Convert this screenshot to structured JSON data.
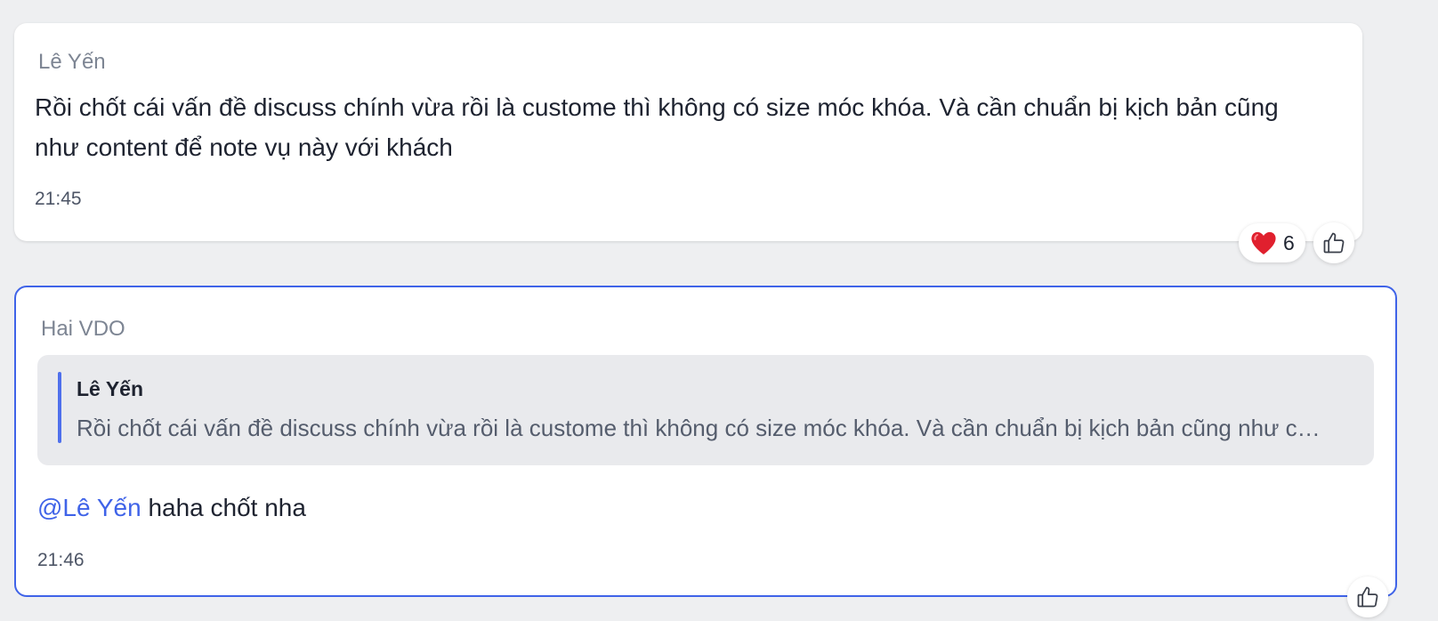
{
  "messages": [
    {
      "sender": "Lê Yến",
      "text": "Rồi chốt cái vấn đề discuss chính vừa rồi là custome thì không có size móc khóa. Và cần chuẩn bị kịch bản cũng như content để note vụ này với khách",
      "time": "21:45",
      "reactions": [
        {
          "icon": "heart-icon",
          "emoji": "❤️",
          "count": "6"
        }
      ],
      "like_icon": "thumbs-up-icon"
    },
    {
      "sender": "Hai VDO",
      "reply_to": {
        "author": "Lê Yến",
        "text": "Rồi chốt cái vấn đề discuss chính vừa rồi là custome thì không có size móc khóa. Và cần chuẩn bị kịch bản cũng như content để note vụ này với khách"
      },
      "mention": "@Lê Yến",
      "text": " haha chốt nha",
      "time": "21:46",
      "like_icon": "thumbs-up-icon"
    }
  ],
  "colors": {
    "background": "#eeeff1",
    "accent": "#3f63e8",
    "heart": "#e0202e"
  }
}
